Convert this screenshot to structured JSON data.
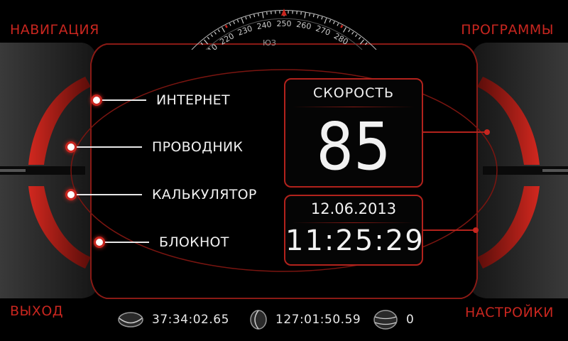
{
  "corners": {
    "top_left": "НАВИГАЦИЯ",
    "top_right": "ПРОГРАММЫ",
    "bottom_left": "ВЫХОД",
    "bottom_right": "НАСТРОЙКИ"
  },
  "compass": {
    "ticks": [
      "210",
      "220",
      "230",
      "240",
      "250",
      "260",
      "270",
      "280"
    ],
    "heading_label": "ЮЗ"
  },
  "menu": [
    {
      "label": "ИНТЕРНЕТ"
    },
    {
      "label": "ПРОВОДНИК"
    },
    {
      "label": "КАЛЬКУЛЯТОР"
    },
    {
      "label": "БЛОКНОТ"
    }
  ],
  "speed": {
    "title": "СКОРОСТЬ",
    "value": "85"
  },
  "datetime": {
    "date": "12.06.2013",
    "time": "11:25:29"
  },
  "status": {
    "latitude": "37:34:02.65",
    "longitude": "127:01:50.59",
    "altitude": "0"
  },
  "colors": {
    "accent": "#c8261f",
    "text": "#f2f2f2",
    "background": "#000000"
  }
}
